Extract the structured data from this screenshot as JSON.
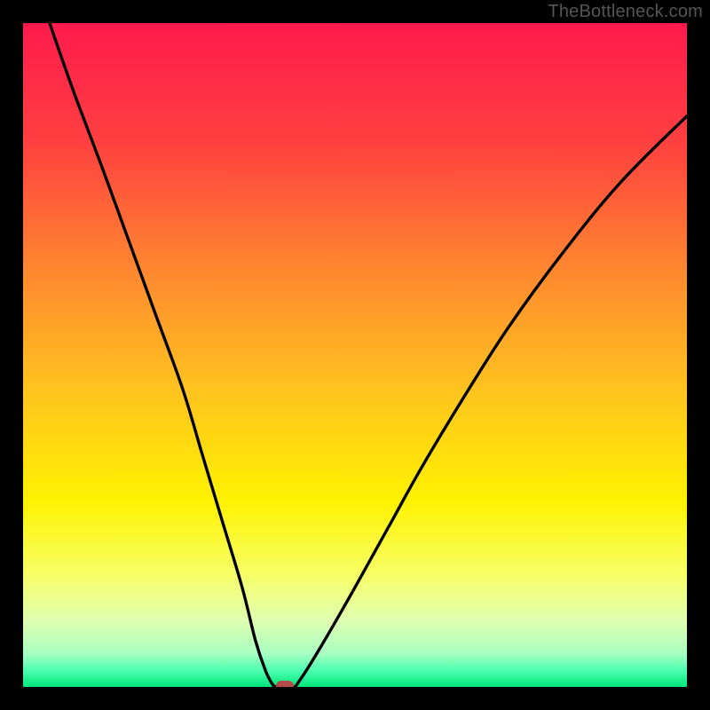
{
  "watermark": "TheBottleneck.com",
  "chart_data": {
    "type": "line",
    "title": "",
    "xlabel": "",
    "ylabel": "",
    "xlim": [
      0,
      100
    ],
    "ylim": [
      0,
      100
    ],
    "grid": false,
    "legend": false,
    "gradient_stops": [
      {
        "pos": 0.0,
        "color": "#ff1a4d"
      },
      {
        "pos": 0.18,
        "color": "#ff4040"
      },
      {
        "pos": 0.38,
        "color": "#ff8a2e"
      },
      {
        "pos": 0.55,
        "color": "#ffc21f"
      },
      {
        "pos": 0.72,
        "color": "#fff200"
      },
      {
        "pos": 0.83,
        "color": "#f7ff66"
      },
      {
        "pos": 0.9,
        "color": "#dfffb0"
      },
      {
        "pos": 0.95,
        "color": "#a7ffc2"
      },
      {
        "pos": 0.975,
        "color": "#4dffb0"
      },
      {
        "pos": 1.0,
        "color": "#00e57a"
      }
    ],
    "series": [
      {
        "name": "left-curve",
        "x": [
          4,
          7.5,
          12,
          16,
          20,
          24,
          27,
          30,
          33,
          35,
          36.5,
          37.5,
          38
        ],
        "y": [
          100,
          90,
          78,
          67,
          56,
          45,
          35,
          25,
          15,
          7,
          2.5,
          0.5,
          0
        ]
      },
      {
        "name": "right-curve",
        "x": [
          41,
          43,
          46,
          50,
          55,
          60,
          66,
          73,
          81,
          90,
          100
        ],
        "y": [
          0,
          3,
          8,
          15,
          24,
          33,
          43,
          54,
          65,
          76,
          86
        ]
      }
    ],
    "bottom_flat": {
      "from_x": 38,
      "to_x": 41,
      "y": 0
    },
    "marker": {
      "x": 39.5,
      "y": 0.2,
      "color": "#b54a4a"
    }
  }
}
